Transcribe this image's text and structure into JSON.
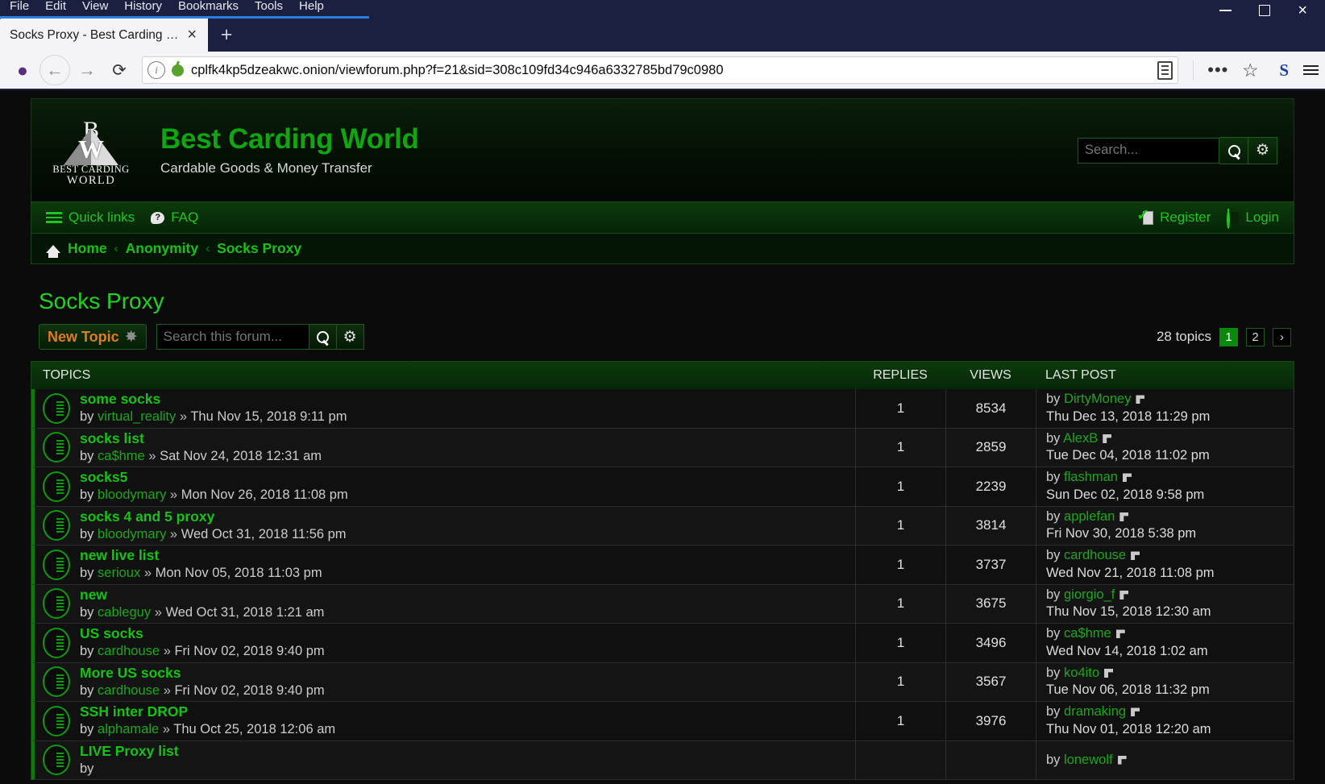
{
  "browser": {
    "menus": [
      "File",
      "Edit",
      "View",
      "History",
      "Bookmarks",
      "Tools",
      "Help"
    ],
    "tab_title": "Socks Proxy - Best Carding World",
    "tab_close_label": "×",
    "new_tab_label": "+",
    "url": "cplfk4kp5dzeakwc.onion/viewforum.php?f=21&sid=308c109fd34c946a6332785bd79c0980",
    "url_info_label": "i",
    "back_label": "←",
    "forward_label": "→",
    "reload_label": "⟳",
    "dots_label": "•••",
    "star_label": "☆",
    "extension_label": "S",
    "minimize_label": "—",
    "maximize_label": "□",
    "close_label": "×"
  },
  "site": {
    "title": "Best Carding World",
    "description": "Cardable Goods & Money Transfer",
    "logo_letters": "B C",
    "logo_w": "W",
    "logo_line1": "BEST CARDING",
    "logo_line2": "WORLD",
    "search_placeholder": "Search...",
    "search_value": "",
    "gear_label": "⚙"
  },
  "navbar": {
    "quick_links": "Quick links",
    "faq": "FAQ",
    "faq_glyph": "?",
    "register": "Register",
    "login": "Login"
  },
  "breadcrumb": {
    "items": [
      {
        "label": "Home"
      },
      {
        "label": "Anonymity"
      },
      {
        "label": "Socks Proxy"
      }
    ],
    "separator": "‹"
  },
  "forum": {
    "title": "Socks Proxy",
    "new_topic_label": "New Topic",
    "new_topic_icon": "✸",
    "search_placeholder": "Search this forum...",
    "search_value": "",
    "gear_label": "⚙",
    "topics_count": "28 topics",
    "pages": [
      "1",
      "2"
    ],
    "next_label": "›",
    "active_page": "1"
  },
  "table": {
    "headers": {
      "topics": "TOPICS",
      "replies": "REPLIES",
      "views": "VIEWS",
      "last_post": "LAST POST"
    },
    "rows": [
      {
        "title": "some socks",
        "by": "by",
        "author": "virtual_reality",
        "sep": "»",
        "date": "Thu Nov 15, 2018 9:11 pm",
        "replies": "1",
        "views": "8534",
        "last_by": "by",
        "last_author": "DirtyMoney",
        "last_date": "Thu Dec 13, 2018 11:29 pm"
      },
      {
        "title": "socks list",
        "by": "by",
        "author": "ca$hme",
        "sep": "»",
        "date": "Sat Nov 24, 2018 12:31 am",
        "replies": "1",
        "views": "2859",
        "last_by": "by",
        "last_author": "AlexB",
        "last_date": "Tue Dec 04, 2018 11:02 pm"
      },
      {
        "title": "socks5",
        "by": "by",
        "author": "bloodymary",
        "sep": "»",
        "date": "Mon Nov 26, 2018 11:08 pm",
        "replies": "1",
        "views": "2239",
        "last_by": "by",
        "last_author": "flashman",
        "last_date": "Sun Dec 02, 2018 9:58 pm"
      },
      {
        "title": "socks 4 and 5 proxy",
        "by": "by",
        "author": "bloodymary",
        "sep": "»",
        "date": "Wed Oct 31, 2018 11:56 pm",
        "replies": "1",
        "views": "3814",
        "last_by": "by",
        "last_author": "applefan",
        "last_date": "Fri Nov 30, 2018 5:38 pm"
      },
      {
        "title": "new live list",
        "by": "by",
        "author": "serioux",
        "sep": "»",
        "date": "Mon Nov 05, 2018 11:03 pm",
        "replies": "1",
        "views": "3737",
        "last_by": "by",
        "last_author": "cardhouse",
        "last_date": "Wed Nov 21, 2018 11:08 pm"
      },
      {
        "title": "new",
        "by": "by",
        "author": "cableguy",
        "sep": "»",
        "date": "Wed Oct 31, 2018 1:21 am",
        "replies": "1",
        "views": "3675",
        "last_by": "by",
        "last_author": "giorgio_f",
        "last_date": "Thu Nov 15, 2018 12:30 am"
      },
      {
        "title": "US socks",
        "by": "by",
        "author": "cardhouse",
        "sep": "»",
        "date": "Fri Nov 02, 2018 9:40 pm",
        "replies": "1",
        "views": "3496",
        "last_by": "by",
        "last_author": "ca$hme",
        "last_date": "Wed Nov 14, 2018 1:02 am"
      },
      {
        "title": "More US socks",
        "by": "by",
        "author": "cardhouse",
        "sep": "»",
        "date": "Fri Nov 02, 2018 9:40 pm",
        "replies": "1",
        "views": "3567",
        "last_by": "by",
        "last_author": "ko4ito",
        "last_date": "Tue Nov 06, 2018 11:32 pm"
      },
      {
        "title": "SSH inter DROP",
        "by": "by",
        "author": "alphamale",
        "sep": "»",
        "date": "Thu Oct 25, 2018 12:06 am",
        "replies": "1",
        "views": "3976",
        "last_by": "by",
        "last_author": "dramaking",
        "last_date": "Thu Nov 01, 2018 12:20 am"
      },
      {
        "title": "LIVE Proxy list",
        "by": "by",
        "author": "",
        "sep": "",
        "date": "",
        "replies": "",
        "views": "",
        "last_by": "by",
        "last_author": "lonewolf",
        "last_date": ""
      }
    ]
  },
  "colors": {
    "brand_green": "#12a512",
    "link_green": "#15c215",
    "accent_orange": "#e07b1e",
    "page_bg": "#0b0b0b"
  }
}
